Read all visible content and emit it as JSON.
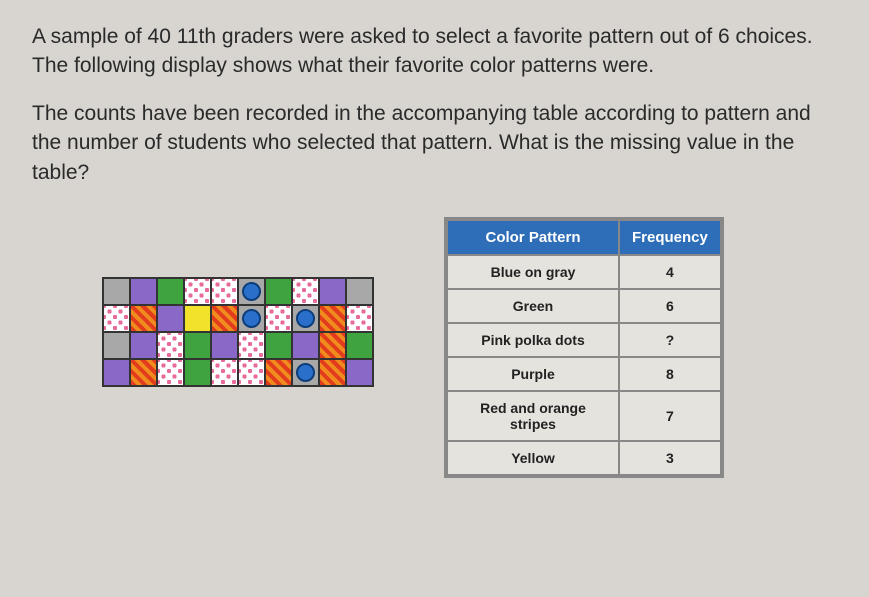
{
  "question": {
    "p1": "A sample of 40 11th graders were asked to select a favorite pattern out of 6 choices. The following display shows what their favorite color patterns were.",
    "p2": "The counts have been recorded in the accompanying table according to pattern and the number of students who selected that pattern. What is the missing value in the table?"
  },
  "chart_data": {
    "type": "table",
    "title": "",
    "headers": {
      "pattern": "Color Pattern",
      "frequency": "Frequency"
    },
    "rows": [
      {
        "pattern": "Blue on gray",
        "frequency": "4"
      },
      {
        "pattern": "Green",
        "frequency": "6"
      },
      {
        "pattern": "Pink polka dots",
        "frequency": "?"
      },
      {
        "pattern": "Purple",
        "frequency": "8"
      },
      {
        "pattern": "Red and orange stripes",
        "frequency": "7"
      },
      {
        "pattern": "Yellow",
        "frequency": "3"
      }
    ],
    "total_sample": 40
  },
  "grid_layout": [
    [
      "gray",
      "purple",
      "green",
      "polka",
      "polka",
      "blue-on-gray",
      "green",
      "polka",
      "purple",
      "gray"
    ],
    [
      "polka",
      "stripes",
      "purple",
      "yellow",
      "stripes",
      "blue-on-gray",
      "polka",
      "blue-on-gray",
      "stripes",
      "polka"
    ],
    [
      "gray",
      "purple",
      "polka",
      "green",
      "purple",
      "polka",
      "green",
      "purple",
      "stripes",
      "green"
    ],
    [
      "purple",
      "stripes",
      "polka",
      "green",
      "polka",
      "polka",
      "stripes",
      "blue-on-gray",
      "stripes",
      "purple"
    ]
  ]
}
